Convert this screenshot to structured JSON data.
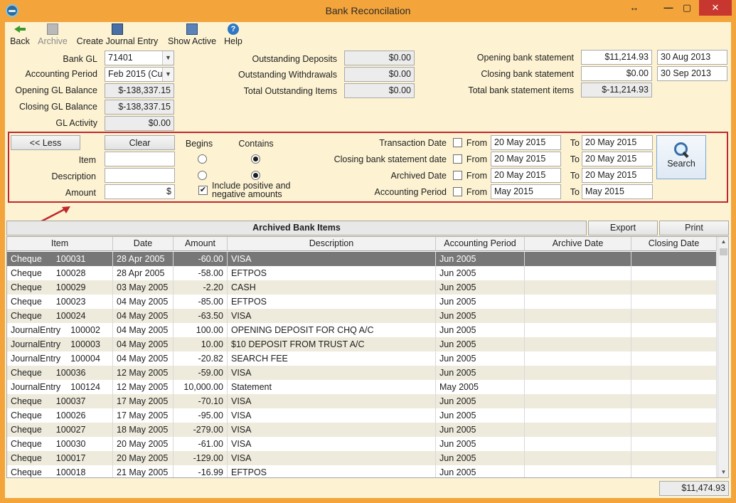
{
  "window": {
    "title": "Bank Reconcilation",
    "resize_glyph": "↔",
    "min_glyph": "—",
    "max_glyph": "▢",
    "close_glyph": "✕"
  },
  "toolbar": {
    "back": "Back",
    "archive": "Archive",
    "create_journal": "Create Journal Entry",
    "show_active": "Show Active",
    "help": "Help",
    "help_glyph": "?"
  },
  "gl": {
    "bank_gl_label": "Bank GL",
    "bank_gl_value": "71401",
    "period_label": "Accounting Period",
    "period_value": "Feb 2015 (Cu",
    "opening_label": "Opening GL Balance",
    "opening_value": "$-138,337.15",
    "closing_label": "Closing GL Balance",
    "closing_value": "$-138,337.15",
    "activity_label": "GL Activity",
    "activity_value": "$0.00"
  },
  "outstanding": {
    "deposits_label": "Outstanding Deposits",
    "deposits_value": "$0.00",
    "withdrawals_label": "Outstanding Withdrawals",
    "withdrawals_value": "$0.00",
    "total_label": "Total Outstanding Items",
    "total_value": "$0.00"
  },
  "statement": {
    "opening_label": "Opening bank statement",
    "opening_value": "$11,214.93",
    "opening_date": "30 Aug 2013",
    "closing_label": "Closing bank statement",
    "closing_value": "$0.00",
    "closing_date": "30 Sep 2013",
    "total_label": "Total bank statement items",
    "total_value": "$-11,214.93"
  },
  "filter": {
    "less_button": "<< Less",
    "clear_button": "Clear",
    "begins_label": "Begins",
    "contains_label": "Contains",
    "item_label": "Item",
    "description_label": "Description",
    "amount_label": "Amount",
    "amount_value": "$",
    "include_label": "Include positive and negative amounts",
    "include_checked": "✔",
    "from_label": "From",
    "to_label": "To",
    "search_button": "Search",
    "rows": [
      {
        "label": "Transaction Date",
        "from": "20 May 2015",
        "to": "20 May 2015"
      },
      {
        "label": "Closing bank statement date",
        "from": "20 May 2015",
        "to": "20 May 2015"
      },
      {
        "label": "Archived Date",
        "from": "20 May 2015",
        "to": "20 May 2015"
      },
      {
        "label": "Accounting Period",
        "from": "May 2015",
        "to": "May 2015"
      }
    ]
  },
  "grid": {
    "title": "Archived Bank Items",
    "export_button": "Export",
    "print_button": "Print",
    "columns": [
      "Item",
      "Date",
      "Amount",
      "Description",
      "Accounting Period",
      "Archive Date",
      "Closing Date"
    ],
    "scroll_up": "▲",
    "scroll_down": "▼",
    "rows": [
      {
        "type": "Cheque",
        "num": "100031",
        "date": "28 Apr 2005",
        "amount": "-60.00",
        "desc": "VISA",
        "period": "Jun 2005"
      },
      {
        "type": "Cheque",
        "num": "100028",
        "date": "28 Apr 2005",
        "amount": "-58.00",
        "desc": "EFTPOS",
        "period": "Jun 2005"
      },
      {
        "type": "Cheque",
        "num": "100029",
        "date": "03 May 2005",
        "amount": "-2.20",
        "desc": "CASH",
        "period": "Jun 2005"
      },
      {
        "type": "Cheque",
        "num": "100023",
        "date": "04 May 2005",
        "amount": "-85.00",
        "desc": "EFTPOS",
        "period": "Jun 2005"
      },
      {
        "type": "Cheque",
        "num": "100024",
        "date": "04 May 2005",
        "amount": "-63.50",
        "desc": "VISA",
        "period": "Jun 2005"
      },
      {
        "type": "JournalEntry",
        "num": "100002",
        "date": "04 May 2005",
        "amount": "100.00",
        "desc": "OPENING DEPOSIT FOR CHQ A/C",
        "period": "Jun 2005"
      },
      {
        "type": "JournalEntry",
        "num": "100003",
        "date": "04 May 2005",
        "amount": "10.00",
        "desc": "$10 DEPOSIT FROM TRUST A/C",
        "period": "Jun 2005"
      },
      {
        "type": "JournalEntry",
        "num": "100004",
        "date": "04 May 2005",
        "amount": "-20.82",
        "desc": "SEARCH FEE",
        "period": "Jun 2005"
      },
      {
        "type": "Cheque",
        "num": "100036",
        "date": "12 May 2005",
        "amount": "-59.00",
        "desc": "VISA",
        "period": "Jun 2005"
      },
      {
        "type": "JournalEntry",
        "num": "100124",
        "date": "12 May 2005",
        "amount": "10,000.00",
        "desc": "Statement",
        "period": "May 2005"
      },
      {
        "type": "Cheque",
        "num": "100037",
        "date": "17 May 2005",
        "amount": "-70.10",
        "desc": "VISA",
        "period": "Jun 2005"
      },
      {
        "type": "Cheque",
        "num": "100026",
        "date": "17 May 2005",
        "amount": "-95.00",
        "desc": "VISA",
        "period": "Jun 2005"
      },
      {
        "type": "Cheque",
        "num": "100027",
        "date": "18 May 2005",
        "amount": "-279.00",
        "desc": "VISA",
        "period": "Jun 2005"
      },
      {
        "type": "Cheque",
        "num": "100030",
        "date": "20 May 2005",
        "amount": "-61.00",
        "desc": "VISA",
        "period": "Jun 2005"
      },
      {
        "type": "Cheque",
        "num": "100017",
        "date": "20 May 2005",
        "amount": "-129.00",
        "desc": "VISA",
        "period": "Jun 2005"
      },
      {
        "type": "Cheque",
        "num": "100018",
        "date": "21 May 2005",
        "amount": "-16.99",
        "desc": "EFTPOS",
        "period": "Jun 2005"
      }
    ],
    "total": "$11,474.93"
  },
  "colors": {
    "window_frame": "#f3a43a",
    "client_bg": "#fdf3d3",
    "selected_row": "#777777",
    "alt_row": "#eeeadc",
    "highlight_border": "#c0272d"
  }
}
